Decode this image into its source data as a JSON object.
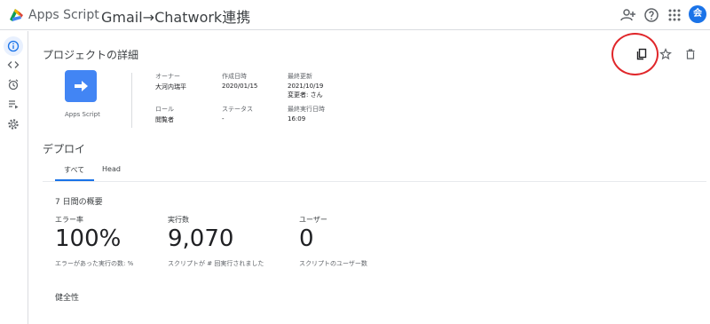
{
  "header": {
    "app_name": "Apps Script",
    "project_title": "Gmail→Chatwork連携",
    "avatar_initial": "会",
    "icons": [
      "add-person-icon",
      "help-icon",
      "apps-grid-icon"
    ]
  },
  "sidenav": {
    "items": [
      {
        "icon": "info-icon",
        "active": true
      },
      {
        "icon": "code-icon",
        "active": false
      },
      {
        "icon": "alarm-icon",
        "active": false
      },
      {
        "icon": "executions-icon",
        "active": false
      },
      {
        "icon": "settings-icon",
        "active": false
      }
    ]
  },
  "project_details": {
    "title": "プロジェクトの詳細",
    "tile_label": "Apps Script",
    "owner_label": "オーナー",
    "owner_value": "大河内瑞平",
    "created_label": "作成日時",
    "created_value": "2020/01/15",
    "updated_label": "最終更新",
    "updated_value": "2021/10/19",
    "updated_by": "変更者: さん",
    "role_label": "ロール",
    "role_value": "閲覧者",
    "status_label": "ステータス",
    "status_value": "-",
    "last_run_label": "最終実行日時",
    "last_run_value": "16:09"
  },
  "deploy": {
    "title": "デプロイ",
    "tabs": [
      {
        "label": "すべて",
        "active": true
      },
      {
        "label": "Head",
        "active": false
      }
    ]
  },
  "overview": {
    "title": "7 日間の概要",
    "error_rate_label": "エラー率",
    "error_rate_value": "100%",
    "error_rate_sub": "エラーがあった実行の数: %",
    "executions_label": "実行数",
    "executions_value": "9,070",
    "executions_sub": "スクリプトが # 回実行されました",
    "users_label": "ユーザー",
    "users_value": "0",
    "users_sub": "スクリプトのユーザー数"
  },
  "health": {
    "title": "健全性"
  },
  "actions": [
    "copy-icon",
    "star-icon",
    "delete-icon"
  ],
  "colors": {
    "accent": "#1a73e8",
    "tile": "#4285f4",
    "annotation": "#e0262a"
  }
}
